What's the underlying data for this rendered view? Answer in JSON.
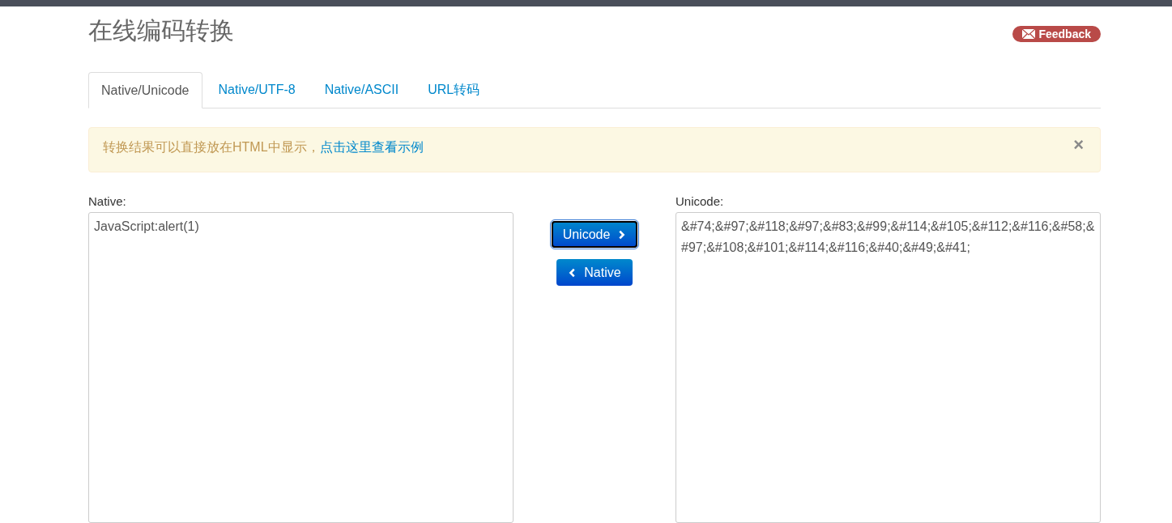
{
  "title": "在线编码转换",
  "feedback": {
    "label": "Feedback"
  },
  "tabs": [
    {
      "label": "Native/Unicode",
      "selected": true
    },
    {
      "label": "Native/UTF-8",
      "selected": false
    },
    {
      "label": "Native/ASCII",
      "selected": false
    },
    {
      "label": "URL转码",
      "selected": false
    }
  ],
  "alert": {
    "text": "转换结果可以直接放在HTML中显示，",
    "link": "点击这里查看示例",
    "close": "×"
  },
  "native": {
    "label": "Native:",
    "value": "JavaScript:alert(1)"
  },
  "buttons": [
    {
      "label": "Unicode",
      "kind": "right",
      "focused": true
    },
    {
      "label": "Native",
      "kind": "left",
      "focused": false
    }
  ],
  "unicode": {
    "label": "Unicode:",
    "value": "&#74;&#97;&#118;&#97;&#83;&#99;&#114;&#105;&#112;&#116;&#58;&#97;&#108;&#101;&#114;&#116;&#40;&#49;&#41;"
  }
}
